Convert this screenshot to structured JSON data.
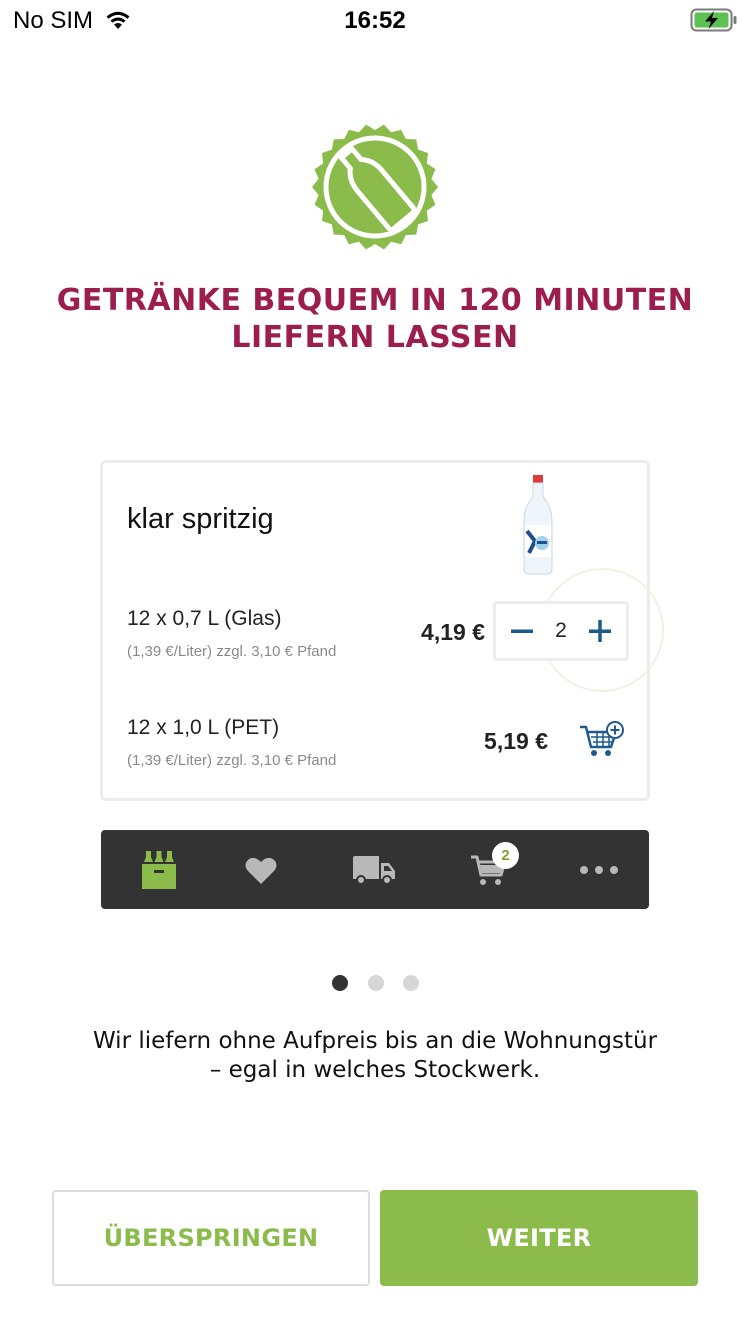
{
  "status_bar": {
    "carrier": "No SIM",
    "time": "16:52"
  },
  "colors": {
    "brand_green": "#8bbb4a",
    "headline_red": "#9c1e4f",
    "tab_bar_bg": "#333333",
    "accent_blue": "#1e5a8c"
  },
  "hero": {
    "logo_icon": "bottle-badge-icon",
    "headline_line1": "GETRÄNKE BEQUEM IN 120 MINUTEN",
    "headline_line2": "LIEFERN LASSEN"
  },
  "product": {
    "name": "klar spritzig",
    "variants": [
      {
        "size": "12 x 0,7 L (Glas)",
        "note": "(1,39 €/Liter) zzgl. 3,10 € Pfand",
        "price": "4,19 €",
        "quantity": "2"
      },
      {
        "size": "12 x 1,0 L (PET)",
        "note": "(1,39 €/Liter) zzgl. 3,10 € Pfand",
        "price": "5,19 €"
      }
    ]
  },
  "tab_bar": {
    "items": [
      "crate-icon",
      "heart-icon",
      "truck-icon",
      "cart-icon",
      "more-icon"
    ],
    "cart_count": "2"
  },
  "pager": {
    "pages": 3,
    "active": 0
  },
  "caption": {
    "line1": "Wir liefern ohne Aufpreis bis an die Wohnungstür",
    "line2": "– egal in welches Stockwerk."
  },
  "buttons": {
    "skip_label": "ÜBERSPRINGEN",
    "next_label": "WEITER"
  }
}
